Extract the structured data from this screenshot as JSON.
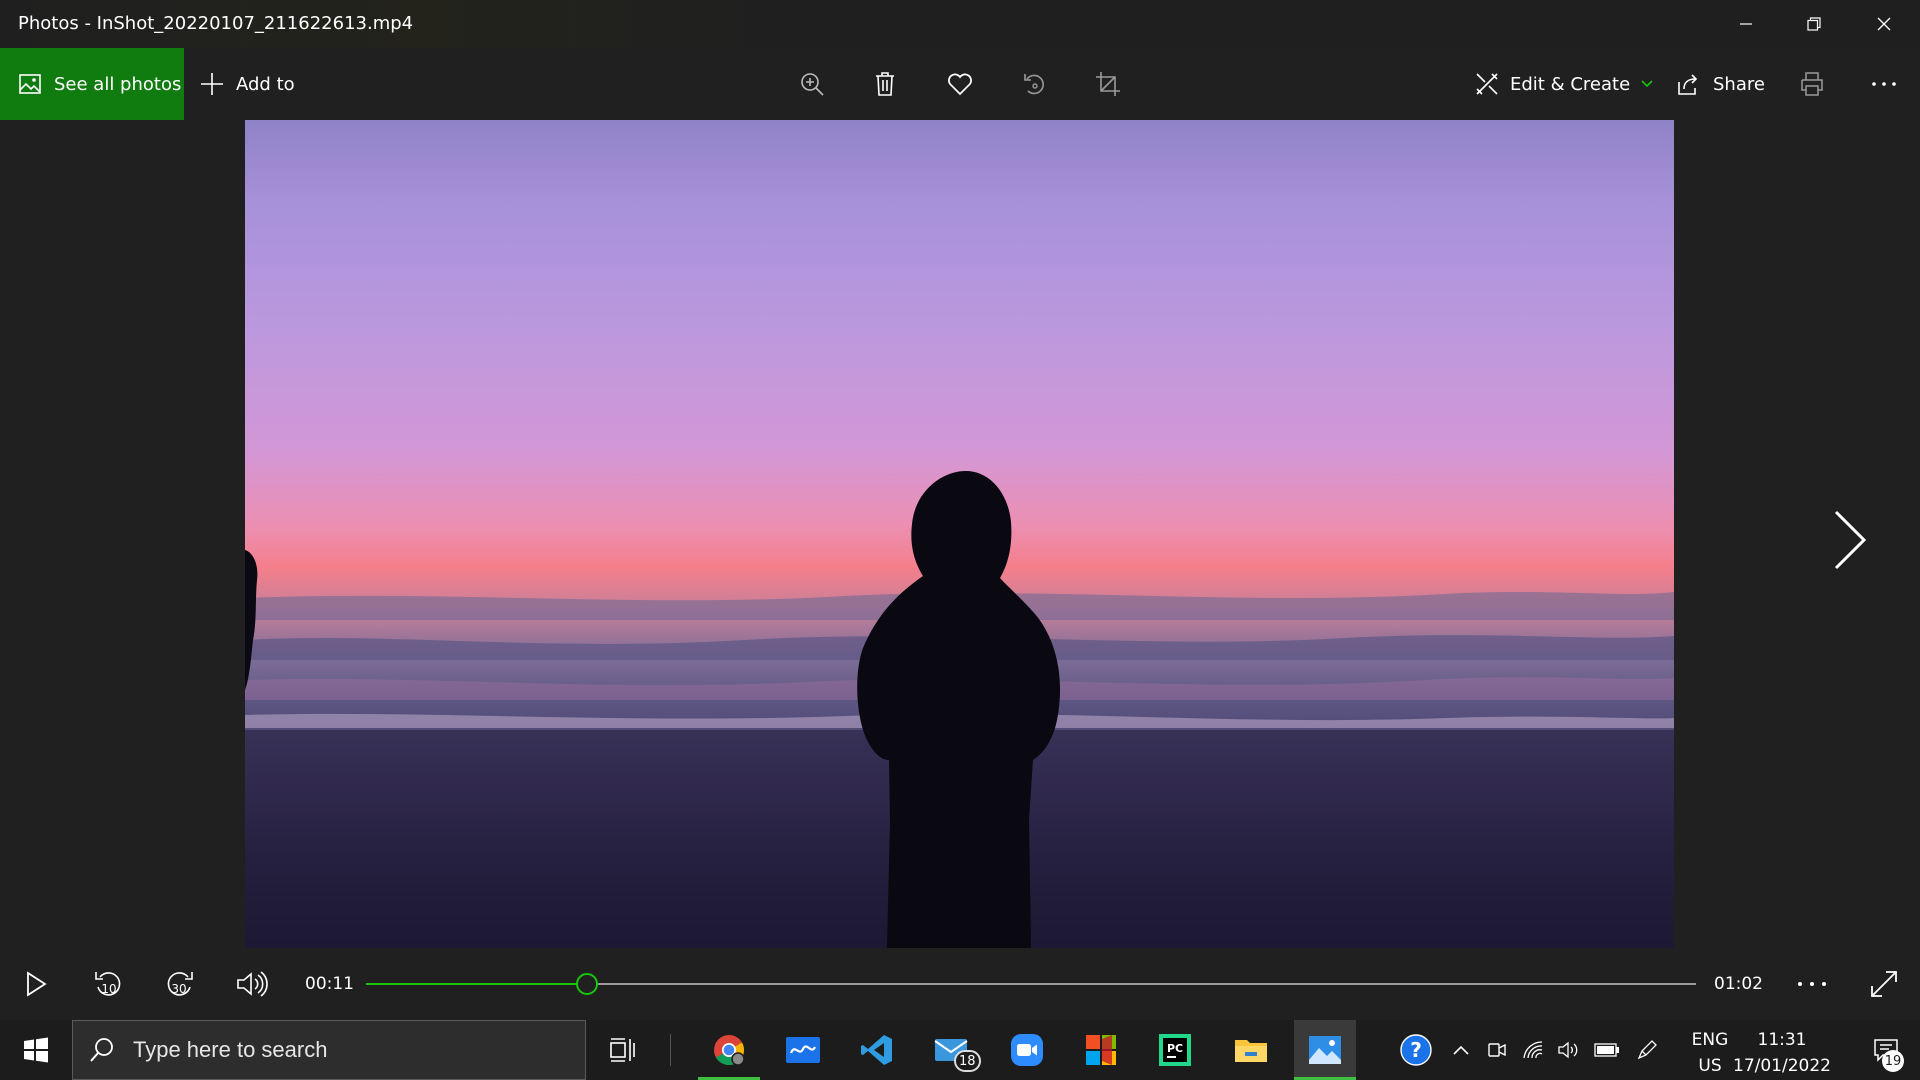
{
  "window": {
    "title": "Photos - InShot_20220107_211622613.mp4",
    "controls": [
      "minimize-icon",
      "restore-icon",
      "close-icon"
    ]
  },
  "command_bar": {
    "see_all_photos": "See all photos",
    "add_to": "Add to",
    "tools": [
      "zoom-in-icon",
      "delete-icon",
      "favorite-icon",
      "rotate-icon",
      "crop-icon"
    ],
    "edit_create": "Edit & Create",
    "share": "Share",
    "more_icon": "more-icon",
    "print_icon": "print-icon"
  },
  "viewer": {
    "media": "sunset beach silhouette video frame",
    "next_icon": "chevron-right-icon"
  },
  "player": {
    "current_time": "00:11",
    "duration": "01:02",
    "progress_fraction": 0.166,
    "accent_color": "#16c60c",
    "buttons": [
      "play-icon",
      "skip-back-10-icon",
      "skip-forward-30-icon",
      "volume-icon",
      "more-icon",
      "fullscreen-icon"
    ],
    "skip_back_label": "10",
    "skip_forward_label": "30"
  },
  "taskbar": {
    "search_placeholder": "Type here to search",
    "apps": [
      "chrome-icon",
      "whiteboard-icon",
      "vscode-icon",
      "mail-icon",
      "zoom-icon",
      "office-icon",
      "pycharm-icon",
      "file-explorer-icon",
      "photos-icon"
    ],
    "mail_badge": "18",
    "language_line1": "ENG",
    "language_line2": "US",
    "time": "11:31",
    "date": "17/01/2022",
    "notification_count": "19"
  },
  "colors": {
    "brand_green": "#107c10",
    "background": "#202020",
    "taskbar": "#1c1c1c"
  }
}
